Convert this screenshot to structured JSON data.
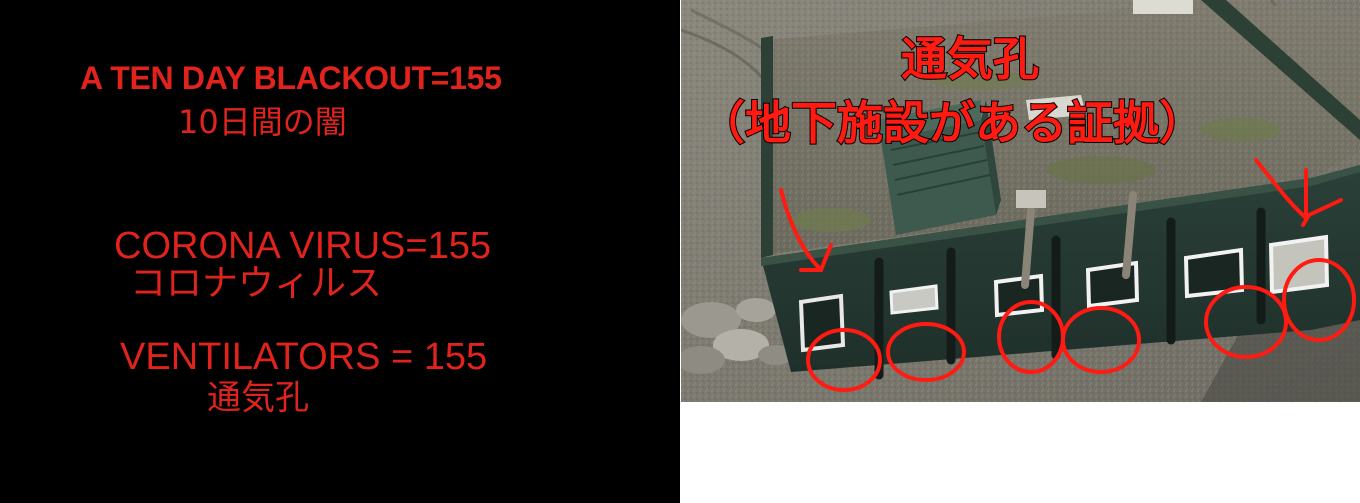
{
  "left_panel": {
    "headline_en": "A TEN DAY BLACKOUT=155",
    "headline_jp": "10日間の闇",
    "corona_en": "CORONA VIRUS=155",
    "corona_jp": "コロナウィルス",
    "ventilators_en": "VENTILATORS = 155",
    "ventilators_jp": "通気孔",
    "background_color": "#000000",
    "text_color": "#e0231c"
  },
  "photo_panel": {
    "title": "通気孔",
    "subtitle": "（地下施設がある証拠）",
    "annotation_color": "#ff1a12",
    "description_icons": [
      "red-circle-annotation",
      "red-arrow-annotation"
    ]
  }
}
